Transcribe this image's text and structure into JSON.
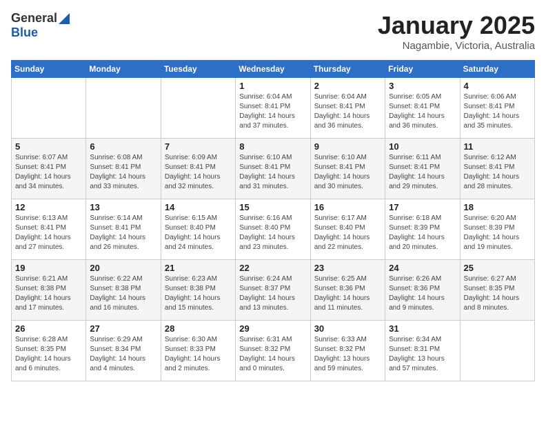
{
  "logo": {
    "general": "General",
    "blue": "Blue"
  },
  "title": "January 2025",
  "subtitle": "Nagambie, Victoria, Australia",
  "days": [
    "Sunday",
    "Monday",
    "Tuesday",
    "Wednesday",
    "Thursday",
    "Friday",
    "Saturday"
  ],
  "weeks": [
    [
      {
        "date": "",
        "sunrise": "",
        "sunset": "",
        "daylight": ""
      },
      {
        "date": "",
        "sunrise": "",
        "sunset": "",
        "daylight": ""
      },
      {
        "date": "",
        "sunrise": "",
        "sunset": "",
        "daylight": ""
      },
      {
        "date": "1",
        "sunrise": "Sunrise: 6:04 AM",
        "sunset": "Sunset: 8:41 PM",
        "daylight": "Daylight: 14 hours and 37 minutes."
      },
      {
        "date": "2",
        "sunrise": "Sunrise: 6:04 AM",
        "sunset": "Sunset: 8:41 PM",
        "daylight": "Daylight: 14 hours and 36 minutes."
      },
      {
        "date": "3",
        "sunrise": "Sunrise: 6:05 AM",
        "sunset": "Sunset: 8:41 PM",
        "daylight": "Daylight: 14 hours and 36 minutes."
      },
      {
        "date": "4",
        "sunrise": "Sunrise: 6:06 AM",
        "sunset": "Sunset: 8:41 PM",
        "daylight": "Daylight: 14 hours and 35 minutes."
      }
    ],
    [
      {
        "date": "5",
        "sunrise": "Sunrise: 6:07 AM",
        "sunset": "Sunset: 8:41 PM",
        "daylight": "Daylight: 14 hours and 34 minutes."
      },
      {
        "date": "6",
        "sunrise": "Sunrise: 6:08 AM",
        "sunset": "Sunset: 8:41 PM",
        "daylight": "Daylight: 14 hours and 33 minutes."
      },
      {
        "date": "7",
        "sunrise": "Sunrise: 6:09 AM",
        "sunset": "Sunset: 8:41 PM",
        "daylight": "Daylight: 14 hours and 32 minutes."
      },
      {
        "date": "8",
        "sunrise": "Sunrise: 6:10 AM",
        "sunset": "Sunset: 8:41 PM",
        "daylight": "Daylight: 14 hours and 31 minutes."
      },
      {
        "date": "9",
        "sunrise": "Sunrise: 6:10 AM",
        "sunset": "Sunset: 8:41 PM",
        "daylight": "Daylight: 14 hours and 30 minutes."
      },
      {
        "date": "10",
        "sunrise": "Sunrise: 6:11 AM",
        "sunset": "Sunset: 8:41 PM",
        "daylight": "Daylight: 14 hours and 29 minutes."
      },
      {
        "date": "11",
        "sunrise": "Sunrise: 6:12 AM",
        "sunset": "Sunset: 8:41 PM",
        "daylight": "Daylight: 14 hours and 28 minutes."
      }
    ],
    [
      {
        "date": "12",
        "sunrise": "Sunrise: 6:13 AM",
        "sunset": "Sunset: 8:41 PM",
        "daylight": "Daylight: 14 hours and 27 minutes."
      },
      {
        "date": "13",
        "sunrise": "Sunrise: 6:14 AM",
        "sunset": "Sunset: 8:41 PM",
        "daylight": "Daylight: 14 hours and 26 minutes."
      },
      {
        "date": "14",
        "sunrise": "Sunrise: 6:15 AM",
        "sunset": "Sunset: 8:40 PM",
        "daylight": "Daylight: 14 hours and 24 minutes."
      },
      {
        "date": "15",
        "sunrise": "Sunrise: 6:16 AM",
        "sunset": "Sunset: 8:40 PM",
        "daylight": "Daylight: 14 hours and 23 minutes."
      },
      {
        "date": "16",
        "sunrise": "Sunrise: 6:17 AM",
        "sunset": "Sunset: 8:40 PM",
        "daylight": "Daylight: 14 hours and 22 minutes."
      },
      {
        "date": "17",
        "sunrise": "Sunrise: 6:18 AM",
        "sunset": "Sunset: 8:39 PM",
        "daylight": "Daylight: 14 hours and 20 minutes."
      },
      {
        "date": "18",
        "sunrise": "Sunrise: 6:20 AM",
        "sunset": "Sunset: 8:39 PM",
        "daylight": "Daylight: 14 hours and 19 minutes."
      }
    ],
    [
      {
        "date": "19",
        "sunrise": "Sunrise: 6:21 AM",
        "sunset": "Sunset: 8:38 PM",
        "daylight": "Daylight: 14 hours and 17 minutes."
      },
      {
        "date": "20",
        "sunrise": "Sunrise: 6:22 AM",
        "sunset": "Sunset: 8:38 PM",
        "daylight": "Daylight: 14 hours and 16 minutes."
      },
      {
        "date": "21",
        "sunrise": "Sunrise: 6:23 AM",
        "sunset": "Sunset: 8:38 PM",
        "daylight": "Daylight: 14 hours and 15 minutes."
      },
      {
        "date": "22",
        "sunrise": "Sunrise: 6:24 AM",
        "sunset": "Sunset: 8:37 PM",
        "daylight": "Daylight: 14 hours and 13 minutes."
      },
      {
        "date": "23",
        "sunrise": "Sunrise: 6:25 AM",
        "sunset": "Sunset: 8:36 PM",
        "daylight": "Daylight: 14 hours and 11 minutes."
      },
      {
        "date": "24",
        "sunrise": "Sunrise: 6:26 AM",
        "sunset": "Sunset: 8:36 PM",
        "daylight": "Daylight: 14 hours and 9 minutes."
      },
      {
        "date": "25",
        "sunrise": "Sunrise: 6:27 AM",
        "sunset": "Sunset: 8:35 PM",
        "daylight": "Daylight: 14 hours and 8 minutes."
      }
    ],
    [
      {
        "date": "26",
        "sunrise": "Sunrise: 6:28 AM",
        "sunset": "Sunset: 8:35 PM",
        "daylight": "Daylight: 14 hours and 6 minutes."
      },
      {
        "date": "27",
        "sunrise": "Sunrise: 6:29 AM",
        "sunset": "Sunset: 8:34 PM",
        "daylight": "Daylight: 14 hours and 4 minutes."
      },
      {
        "date": "28",
        "sunrise": "Sunrise: 6:30 AM",
        "sunset": "Sunset: 8:33 PM",
        "daylight": "Daylight: 14 hours and 2 minutes."
      },
      {
        "date": "29",
        "sunrise": "Sunrise: 6:31 AM",
        "sunset": "Sunset: 8:32 PM",
        "daylight": "Daylight: 14 hours and 0 minutes."
      },
      {
        "date": "30",
        "sunrise": "Sunrise: 6:33 AM",
        "sunset": "Sunset: 8:32 PM",
        "daylight": "Daylight: 13 hours and 59 minutes."
      },
      {
        "date": "31",
        "sunrise": "Sunrise: 6:34 AM",
        "sunset": "Sunset: 8:31 PM",
        "daylight": "Daylight: 13 hours and 57 minutes."
      },
      {
        "date": "",
        "sunrise": "",
        "sunset": "",
        "daylight": ""
      }
    ]
  ]
}
